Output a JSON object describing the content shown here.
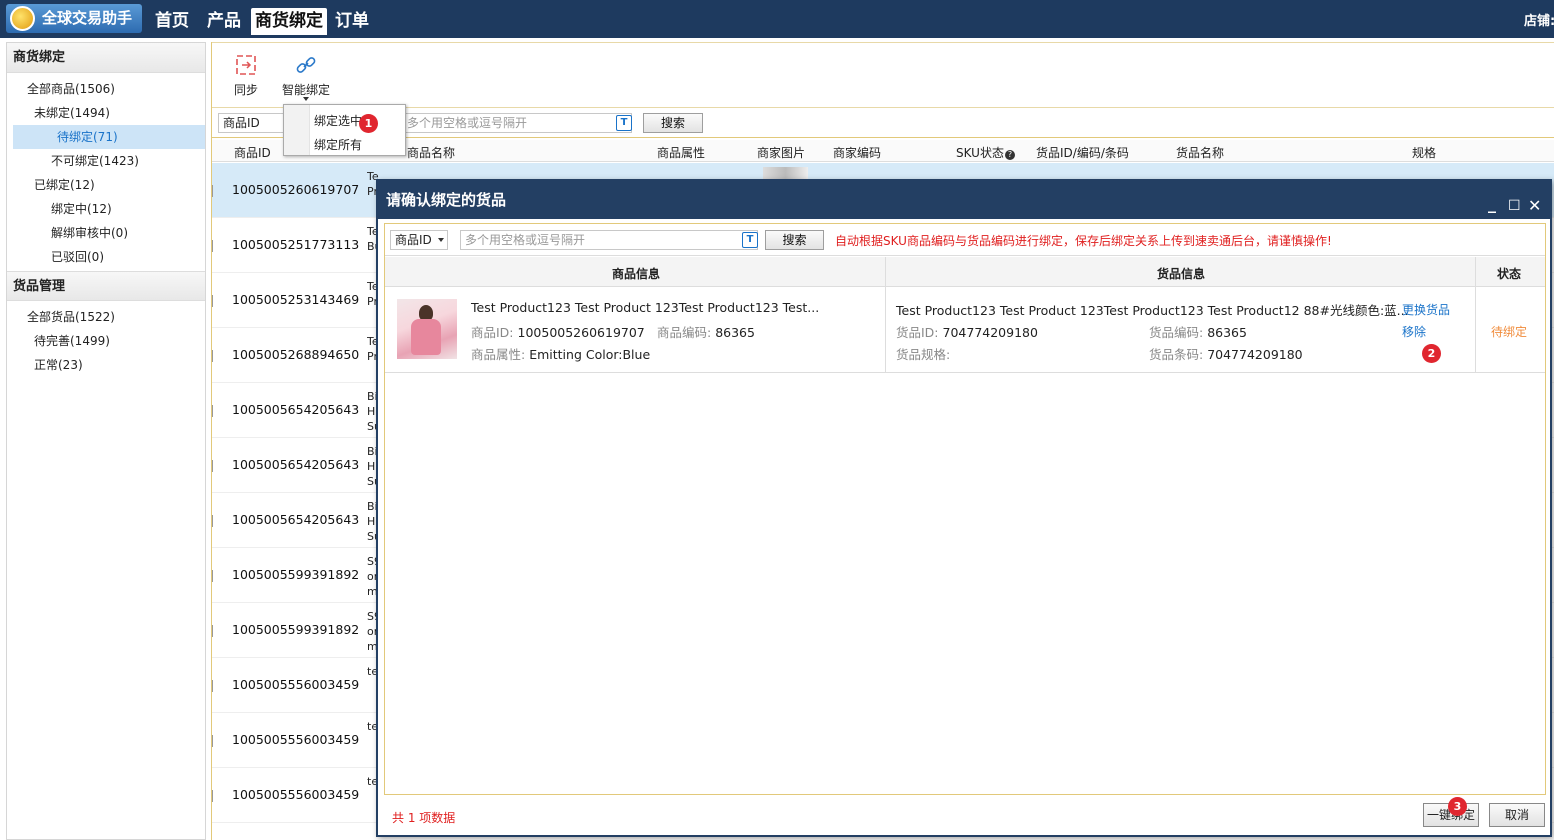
{
  "app": {
    "title": "全球交易助手",
    "store_label": "店铺:"
  },
  "topnav": [
    "首页",
    "产品",
    "商货绑定",
    "订单"
  ],
  "sidebar": {
    "section1": "商货绑定",
    "items1": [
      "全部商品(1506)",
      "未绑定(1494)",
      "待绑定(71)",
      "不可绑定(1423)",
      "已绑定(12)",
      "绑定中(12)",
      "解绑审核中(0)",
      "已驳回(0)"
    ],
    "section2": "货品管理",
    "items2": [
      "全部货品(1522)",
      "待完善(1499)",
      "正常(23)"
    ]
  },
  "toolbar": {
    "sync_label": "同步",
    "smart_bind_label": "智能绑定"
  },
  "popup_menu": {
    "items": [
      "绑定选中",
      "绑定所有"
    ]
  },
  "search": {
    "field": "商品ID",
    "placeholder": "多个用空格或逗号隔开",
    "button": "搜索"
  },
  "grid": {
    "headers": [
      "商品ID",
      "商品名称",
      "商品属性",
      "商家图片",
      "商家编码",
      "SKU状态",
      "货品ID/编码/条码",
      "货品名称",
      "规格"
    ],
    "rows": [
      {
        "id": "1005005260619707",
        "name": "Te Pr"
      },
      {
        "id": "1005005251773113",
        "name": "Te Bu"
      },
      {
        "id": "1005005253143469",
        "name": "Te Pr"
      },
      {
        "id": "1005005268894650",
        "name": "Te Pr"
      },
      {
        "id": "1005005654205643",
        "name": "Bi H Su"
      },
      {
        "id": "1005005654205643",
        "name": "Bi H Su"
      },
      {
        "id": "1005005654205643",
        "name": "Bi H Su"
      },
      {
        "id": "1005005599391892",
        "name": "S9 or m"
      },
      {
        "id": "1005005599391892",
        "name": "S9 or m"
      },
      {
        "id": "1005005556003459",
        "name": "te"
      },
      {
        "id": "1005005556003459",
        "name": "te"
      },
      {
        "id": "1005005556003459",
        "name": "te"
      }
    ]
  },
  "dialog": {
    "title": "请确认绑定的货品",
    "search_field": "商品ID",
    "search_placeholder": "多个用空格或逗号隔开",
    "search_button": "搜索",
    "notice": "自动根据SKU商品编码与货品编码进行绑定，保存后绑定关系上传到速卖通后台，请谨慎操作!",
    "col_product": "商品信息",
    "col_goods": "货品信息",
    "col_status": "状态",
    "row": {
      "product_title": "Test Product123 Test Product 123Test Product123 Test...",
      "product_id_label": "商品ID:",
      "product_id": "1005005260619707",
      "product_code_label": "商品编码:",
      "product_code": "86365",
      "product_attr_label": "商品属性:",
      "product_attr": "Emitting Color:Blue",
      "goods_title": "Test Product123 Test Product 123Test Product123 Test Product12 88#光线颜色:蓝...",
      "goods_id_label": "货品ID:",
      "goods_id": "704774209180",
      "goods_code_label": "货品编码:",
      "goods_code": "86365",
      "goods_spec_label": "货品规格:",
      "goods_barcode_label": "货品条码:",
      "goods_barcode": "704774209180",
      "action_replace": "更换货品",
      "action_remove": "移除",
      "status": "待绑定"
    },
    "footer_count": "共 1 项数据",
    "btn_bind": "一键绑定",
    "btn_cancel": "取消"
  },
  "badges": [
    "1",
    "2",
    "3"
  ],
  "colors": {
    "topbar": "#1e3a5f",
    "accent_link": "#1a73c9",
    "warning": "#e02020",
    "status_pending": "#f08c3c"
  }
}
